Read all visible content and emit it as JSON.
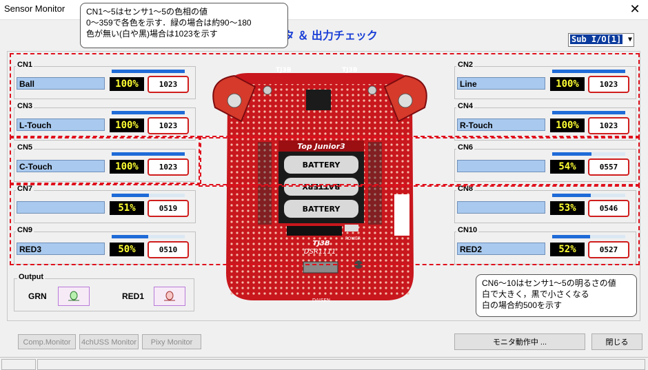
{
  "window": {
    "title": "Sensor Monitor",
    "close_label": "✕"
  },
  "header": {
    "title_visible": "ニタ ＆ 出力チェック"
  },
  "io_select": {
    "value": "Sub I/O[1]",
    "arrow": "▼"
  },
  "sensors": [
    {
      "id": "CN1",
      "name": "Ball",
      "percent": "100%",
      "value": "1023",
      "level": 1.0
    },
    {
      "id": "CN3",
      "name": "L-Touch",
      "percent": "100%",
      "value": "1023",
      "level": 1.0
    },
    {
      "id": "CN5",
      "name": "C-Touch",
      "percent": "100%",
      "value": "1023",
      "level": 1.0
    },
    {
      "id": "CN7",
      "name": "",
      "percent": "51%",
      "value": "0519",
      "level": 0.51
    },
    {
      "id": "CN9",
      "name": "RED3",
      "percent": "50%",
      "value": "0510",
      "level": 0.5
    },
    {
      "id": "CN2",
      "name": "Line",
      "percent": "100%",
      "value": "1023",
      "level": 1.0
    },
    {
      "id": "CN4",
      "name": "R-Touch",
      "percent": "100%",
      "value": "1023",
      "level": 1.0
    },
    {
      "id": "CN6",
      "name": "",
      "percent": "54%",
      "value": "0557",
      "level": 0.54
    },
    {
      "id": "CN8",
      "name": "",
      "percent": "53%",
      "value": "0546",
      "level": 0.53
    },
    {
      "id": "CN10",
      "name": "RED2",
      "percent": "52%",
      "value": "0527",
      "level": 0.52
    }
  ],
  "callouts": {
    "top": [
      "CN1～5はセンサ1～5の色相の値",
      "0～359で各色を示す．緑の場合は約90～180",
      "色が無い(白や黒)場合は1023を示す"
    ],
    "bottom": [
      "CN6～10はセンサ1～5の明るさの値",
      "白で大きく，黒で小さくなる",
      "白の場合約500を示す"
    ]
  },
  "board": {
    "brand": "Top Junior3",
    "battery": [
      "BATTERY",
      "BATTERY",
      "BATTERY"
    ],
    "tj3_top_left": "TJ3B",
    "tj3_top_right": "TJ3B",
    "dsr": "DSR1111",
    "tj3_bottom": "TJ3B",
    "bottom_label": "DAISEN",
    "power": "POWER"
  },
  "output": {
    "label": "Output",
    "grn": "GRN",
    "red": "RED1"
  },
  "buttons": {
    "comp_monitor": "Comp.Monitor",
    "uss_monitor": "4chUSS Monitor",
    "pixy_monitor": "Pixy Monitor",
    "monitor_running": "モニタ動作中 ...",
    "close": "閉じる"
  },
  "colors": {
    "accent_blue": "#1f6bd8",
    "dash_red": "#e0101c",
    "board_red": "#c8171d",
    "value_yellow": "#ffff33"
  }
}
